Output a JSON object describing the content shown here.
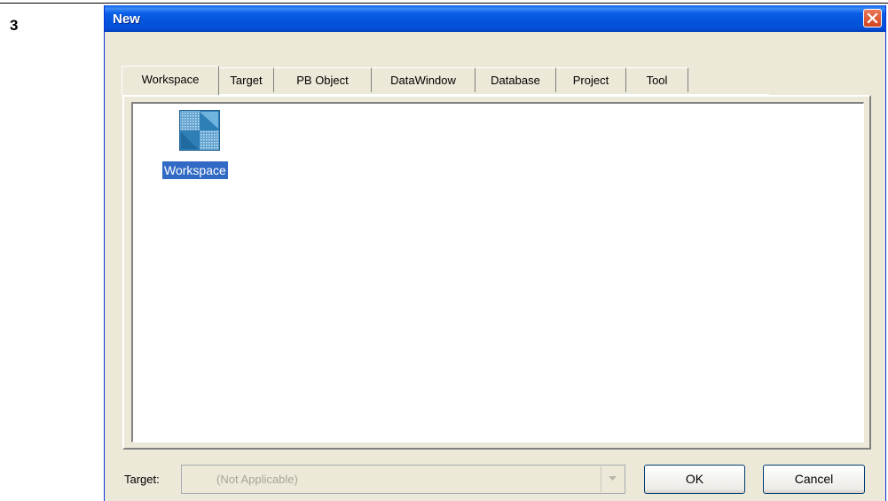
{
  "step_number": "3",
  "dialog": {
    "title": "New",
    "close_icon": "close-icon"
  },
  "tabs": [
    {
      "label": "Workspace",
      "active": true
    },
    {
      "label": "Target",
      "active": false
    },
    {
      "label": "PB Object",
      "active": false
    },
    {
      "label": "DataWindow",
      "active": false
    },
    {
      "label": "Database",
      "active": false
    },
    {
      "label": "Project",
      "active": false
    },
    {
      "label": "Tool",
      "active": false
    }
  ],
  "items": [
    {
      "label": "Workspace",
      "icon": "workspace-icon",
      "selected": true
    }
  ],
  "target": {
    "label": "Target:",
    "value": "(Not Applicable)",
    "enabled": false
  },
  "buttons": {
    "ok": "OK",
    "cancel": "Cancel"
  },
  "colors": {
    "title_bar": "#0454db",
    "dialog_bg": "#ece9d8",
    "selection": "#316ac5",
    "close_button": "#d4431f"
  }
}
